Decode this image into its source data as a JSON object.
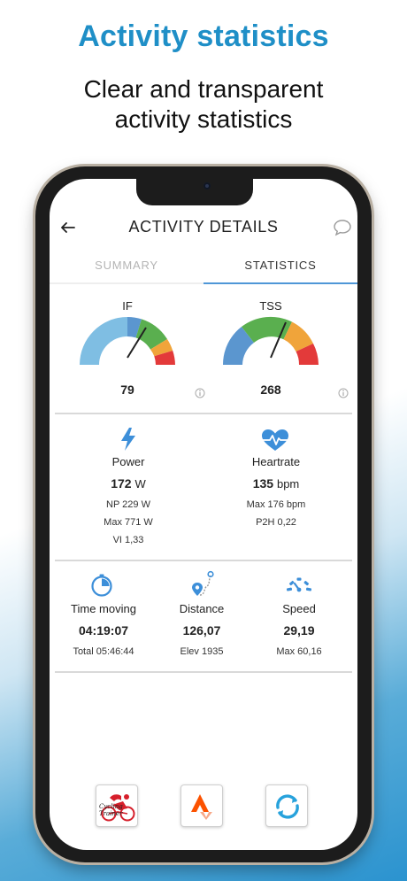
{
  "promo": {
    "headline": "Activity statistics",
    "subline_1": "Clear and transparent",
    "subline_2": "activity statistics"
  },
  "header": {
    "title": "ACTIVITY DETAILS",
    "back_icon": "arrow-left-icon",
    "comment_icon": "speech-bubble-icon"
  },
  "tabs": [
    {
      "label": "SUMMARY",
      "active": false
    },
    {
      "label": "STATISTICS",
      "active": true
    }
  ],
  "gauges": [
    {
      "label": "IF",
      "value": "79",
      "info_icon": "info-icon"
    },
    {
      "label": "TSS",
      "value": "268",
      "info_icon": "info-icon"
    }
  ],
  "power": {
    "icon": "lightning-bolt-icon",
    "label": "Power",
    "value": "172",
    "unit": "W",
    "lines": [
      "NP 229 W",
      "Max 771 W",
      "VI 1,33"
    ]
  },
  "heartrate": {
    "icon": "heartbeat-icon",
    "label": "Heartrate",
    "value": "135",
    "unit": "bpm",
    "lines": [
      "Max 176 bpm",
      "P2H 0,22"
    ]
  },
  "time_moving": {
    "icon": "stopwatch-icon",
    "label": "Time moving",
    "value": "04:19:07",
    "sub": "Total 05:46:44"
  },
  "distance": {
    "icon": "route-pin-icon",
    "label": "Distance",
    "value": "126,07",
    "sub": "Elev 1935"
  },
  "speed": {
    "icon": "speedometer-icon",
    "label": "Speed",
    "value": "29,19",
    "sub": "Max 60,16"
  },
  "bottom_apps": [
    {
      "name": "cycling-trainer-logo",
      "text": "Cycling Trainer"
    },
    {
      "name": "strava-logo"
    },
    {
      "name": "sync-logo"
    }
  ],
  "colors": {
    "accent": "#1f8fc7",
    "tab_indicator": "#4f97d7",
    "icon_blue": "#3d8fd9"
  }
}
